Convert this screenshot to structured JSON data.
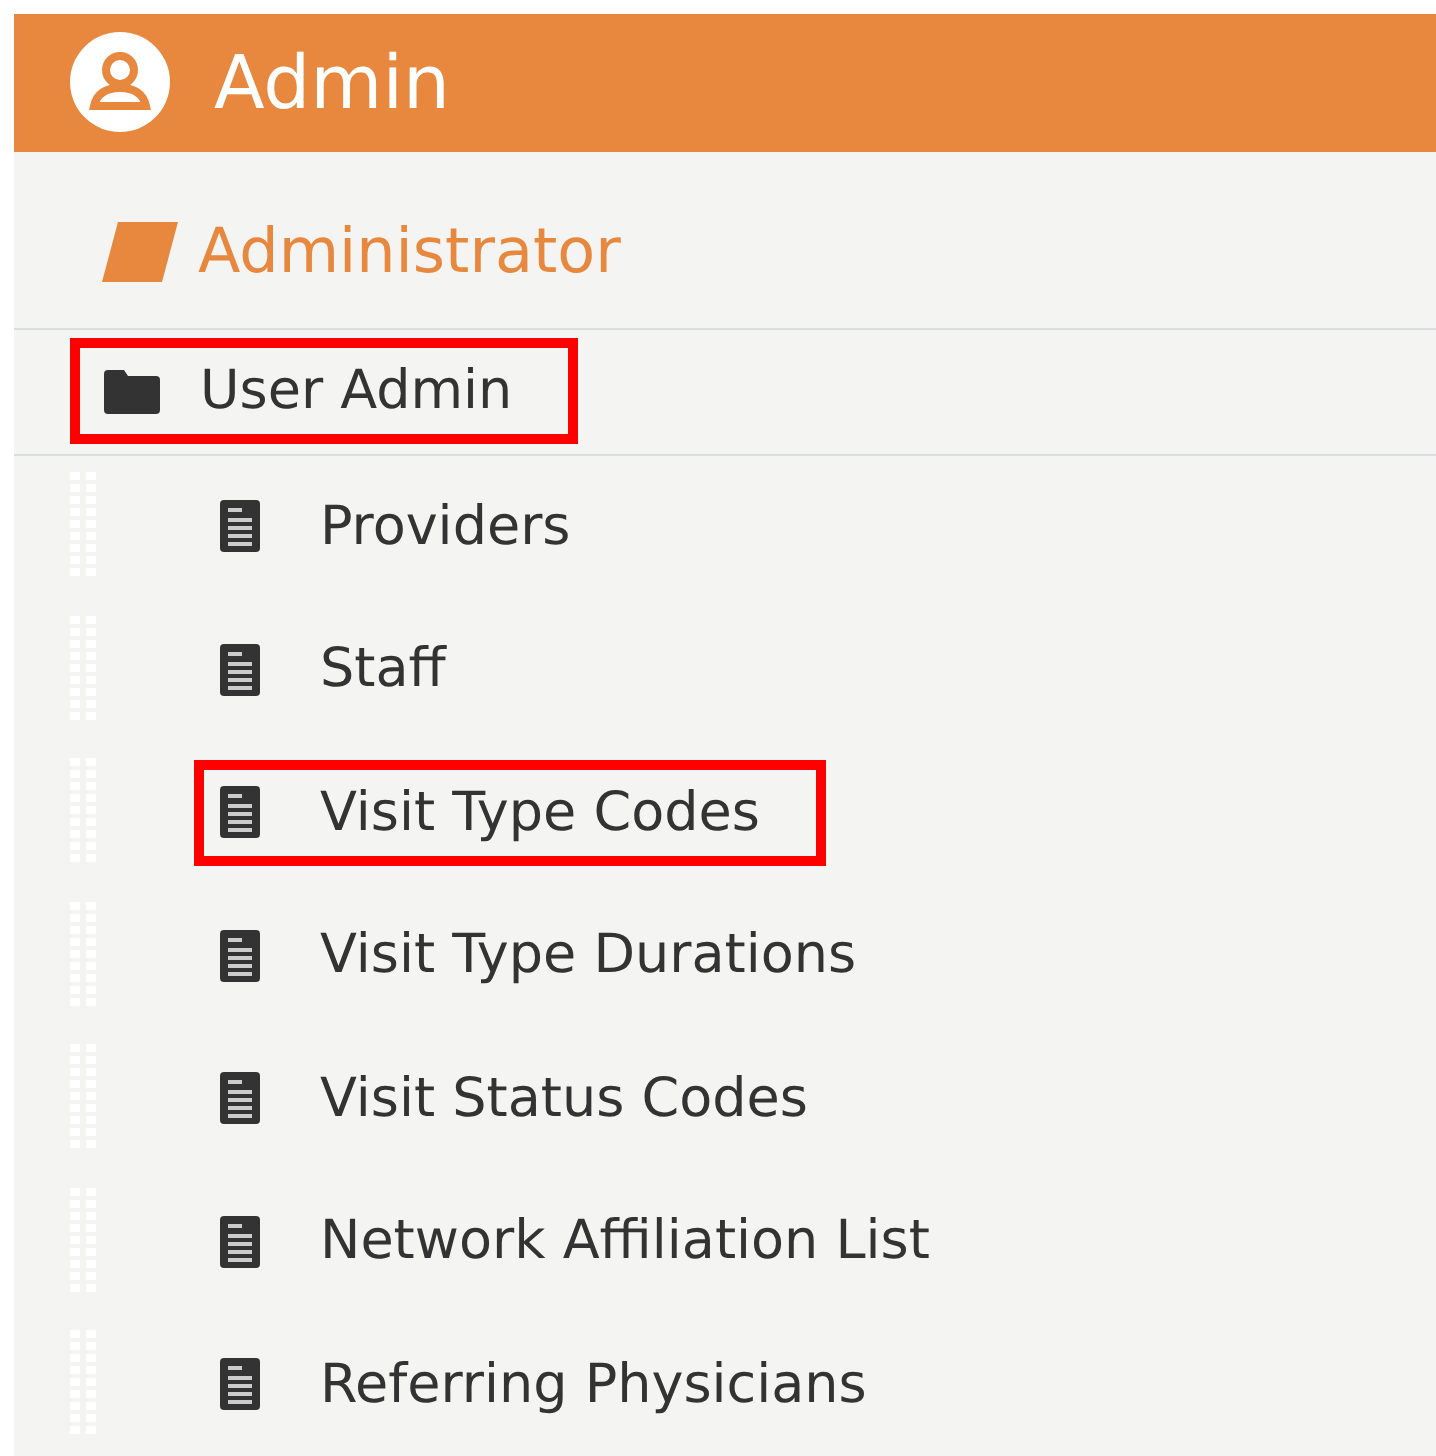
{
  "header": {
    "title": "Admin"
  },
  "section": {
    "title": "Administrator"
  },
  "folder": {
    "label": "User Admin",
    "highlighted": true,
    "children": [
      {
        "label": "Providers",
        "highlighted": false
      },
      {
        "label": "Staff",
        "highlighted": false
      },
      {
        "label": "Visit Type Codes",
        "highlighted": true
      },
      {
        "label": "Visit Type Durations",
        "highlighted": false
      },
      {
        "label": "Visit Status Codes",
        "highlighted": false
      },
      {
        "label": "Network Affiliation List",
        "highlighted": false
      },
      {
        "label": "Referring Physicians",
        "highlighted": false
      }
    ]
  }
}
